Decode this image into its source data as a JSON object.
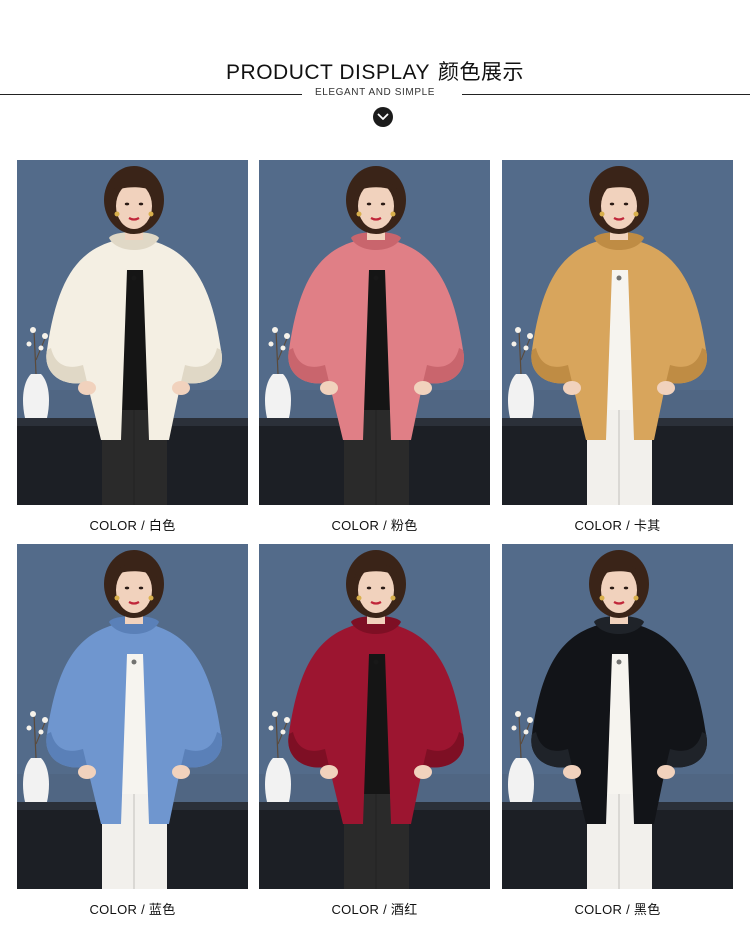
{
  "header": {
    "title_en": "PRODUCT DISPLAY",
    "title_cn": "颜色展示",
    "subtitle": "ELEGANT AND SIMPLE"
  },
  "products": [
    {
      "label": "COLOR / ",
      "color_name": "白色",
      "coat_color": "#f4efe3",
      "coat_shade": "#e0d8c6",
      "inner": "#151515",
      "bottom": "#2a2a2a"
    },
    {
      "label": "COLOR / ",
      "color_name": "粉色",
      "coat_color": "#e07f86",
      "coat_shade": "#c9656d",
      "inner": "#151515",
      "bottom": "#2a2a2a"
    },
    {
      "label": "COLOR / ",
      "color_name": "卡其",
      "coat_color": "#d8a55c",
      "coat_shade": "#bf8c44",
      "inner": "#f6f4ef",
      "bottom": "#f2f0ec"
    },
    {
      "label": "COLOR / ",
      "color_name": "蓝色",
      "coat_color": "#6f96cf",
      "coat_shade": "#5a80b8",
      "inner": "#f6f4ef",
      "bottom": "#f2f0ec"
    },
    {
      "label": "COLOR / ",
      "color_name": "酒红",
      "coat_color": "#9c1530",
      "coat_shade": "#7e0f24",
      "inner": "#151515",
      "bottom": "#2a2a2a"
    },
    {
      "label": "COLOR / ",
      "color_name": "黑色",
      "coat_color": "#121418",
      "coat_shade": "#1f2329",
      "inner": "#f6f4ef",
      "bottom": "#f2f0ec"
    }
  ]
}
